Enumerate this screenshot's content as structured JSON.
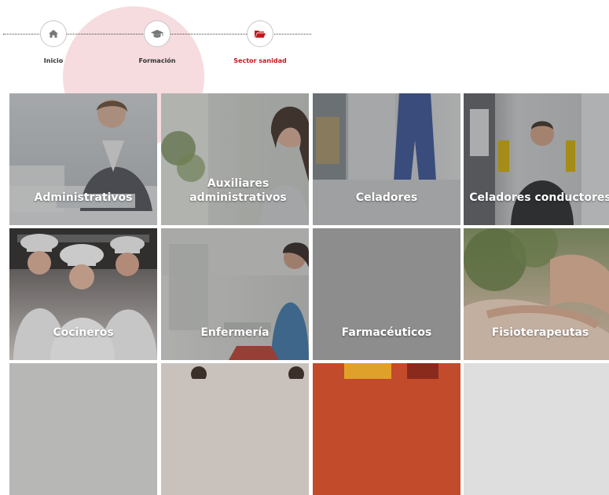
{
  "breadcrumb": {
    "steps": [
      {
        "label": "Inicio",
        "icon": "home-icon",
        "active": false
      },
      {
        "label": "Formación",
        "icon": "graduation-cap-icon",
        "active": false
      },
      {
        "label": "Sector sanidad",
        "icon": "folder-open-icon",
        "active": true
      }
    ],
    "colors": {
      "accent": "#c4161c",
      "highlight": "#f6dadd"
    }
  },
  "tiles": [
    {
      "label": "Administrativos"
    },
    {
      "label": "Auxiliares administrativos"
    },
    {
      "label": "Celadores"
    },
    {
      "label": "Celadores conductores"
    },
    {
      "label": "Cocineros"
    },
    {
      "label": "Enfermería"
    },
    {
      "label": "Farmacéuticos"
    },
    {
      "label": "Fisioterapeutas"
    }
  ]
}
